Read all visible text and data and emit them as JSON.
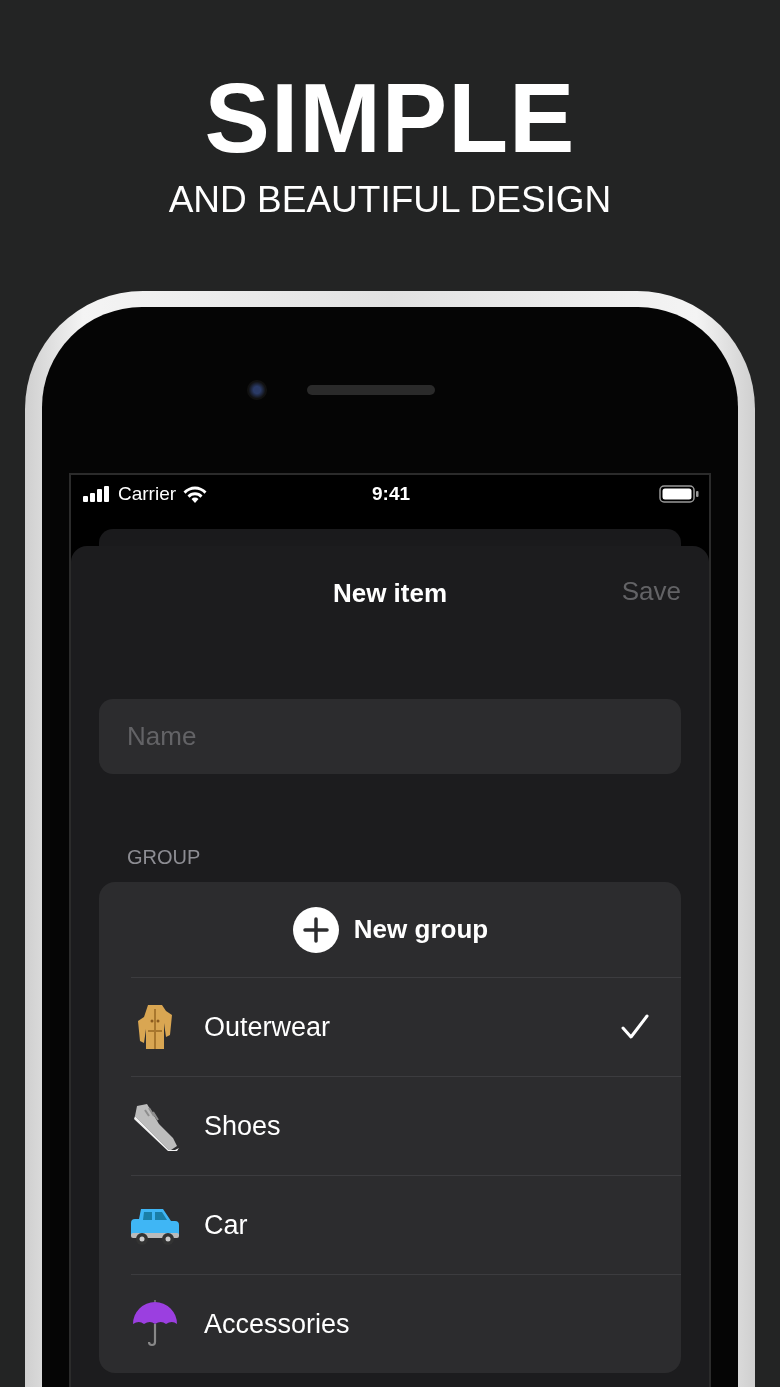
{
  "headline": {
    "title": "SIMPLE",
    "subtitle": "AND BEAUTIFUL DESIGN"
  },
  "status_bar": {
    "carrier": "Carrier",
    "time": "9:41"
  },
  "sheet": {
    "title": "New item",
    "save_button": {
      "label": "Save",
      "disabled": true
    }
  },
  "name_field": {
    "placeholder": "Name"
  },
  "group_section": {
    "label": "GROUP",
    "new_group_button": "New group",
    "groups": [
      {
        "label": "Outerwear",
        "selected": true
      },
      {
        "label": "Shoes",
        "selected": false
      },
      {
        "label": "Car",
        "selected": false
      },
      {
        "label": "Accessories",
        "selected": false
      }
    ]
  }
}
